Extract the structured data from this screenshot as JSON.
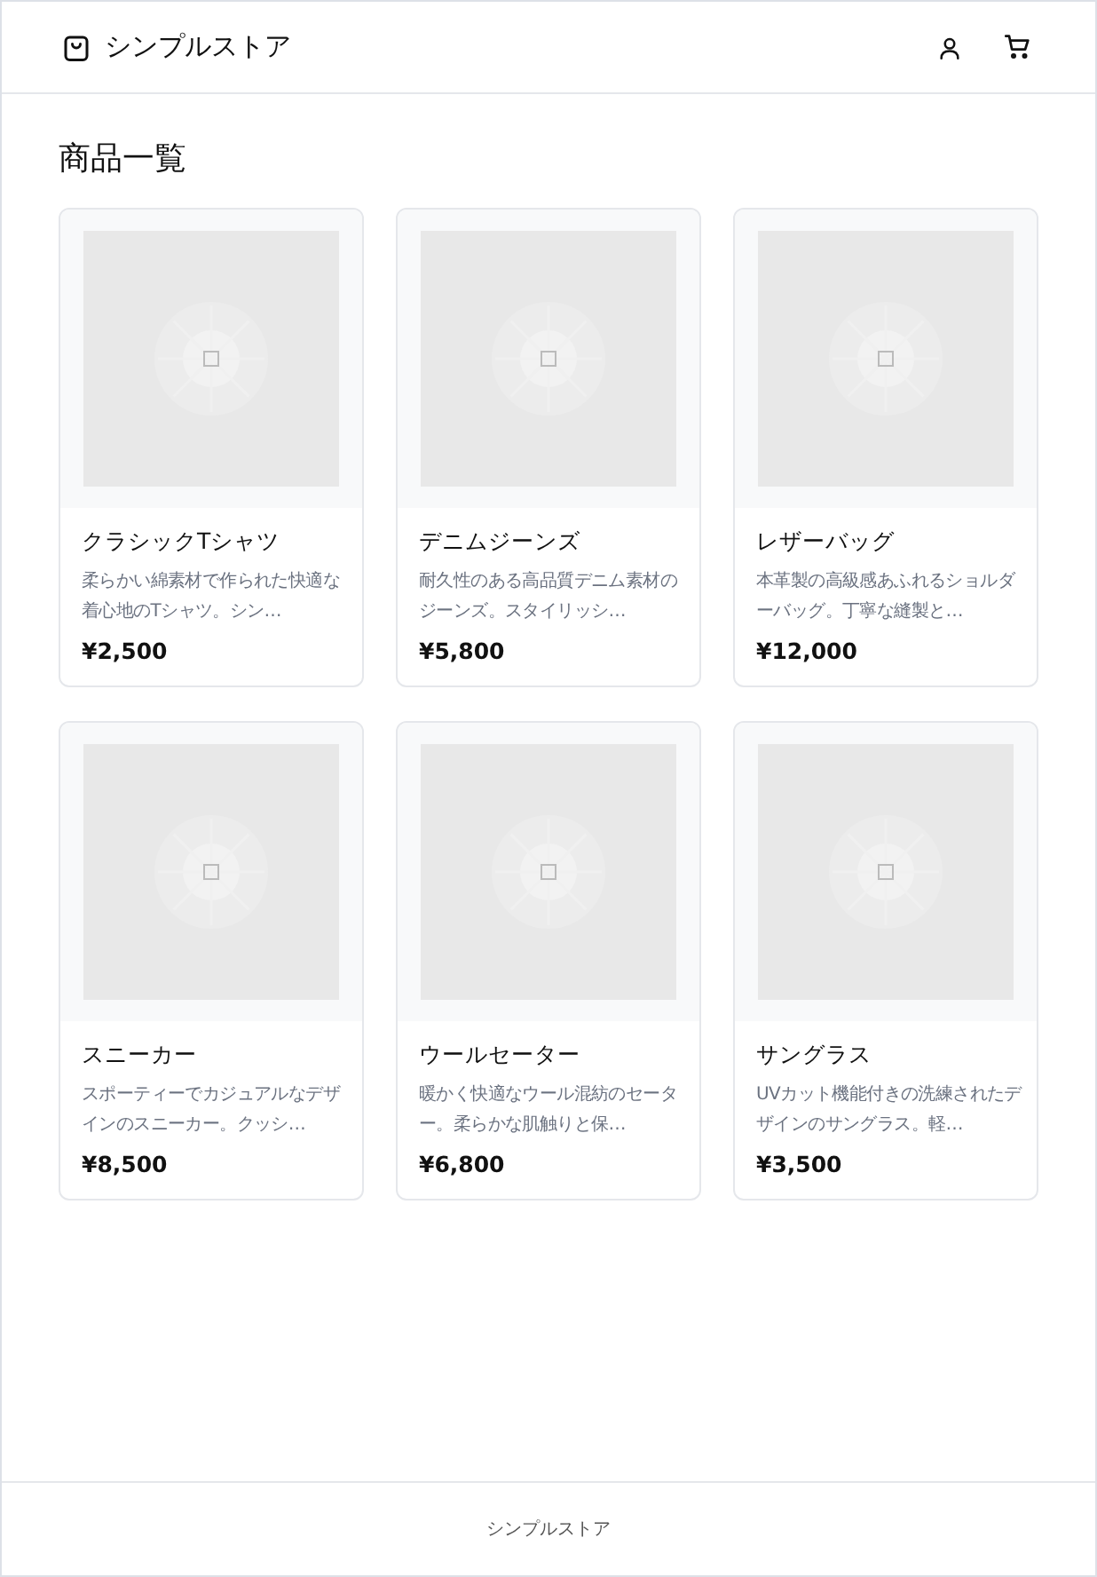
{
  "header": {
    "store_name": "シンプルストア"
  },
  "page_title": "商品一覧",
  "products": [
    {
      "name": "クラシックTシャツ",
      "description": "柔らかい綿素材で作られた快適な着心地のTシャツ。シン…",
      "price": "¥2,500"
    },
    {
      "name": "デニムジーンズ",
      "description": "耐久性のある高品質デニム素材のジーンズ。スタイリッシ…",
      "price": "¥5,800"
    },
    {
      "name": "レザーバッグ",
      "description": "本革製の高級感あふれるショルダーバッグ。丁寧な縫製と…",
      "price": "¥12,000"
    },
    {
      "name": "スニーカー",
      "description": "スポーティーでカジュアルなデザインのスニーカー。クッシ…",
      "price": "¥8,500"
    },
    {
      "name": "ウールセーター",
      "description": "暖かく快適なウール混紡のセーター。柔らかな肌触りと保…",
      "price": "¥6,800"
    },
    {
      "name": "サングラス",
      "description": "UVカット機能付きの洗練されたデザインのサングラス。軽…",
      "price": "¥3,500"
    }
  ],
  "footer": {
    "text": "シンプルストア"
  }
}
